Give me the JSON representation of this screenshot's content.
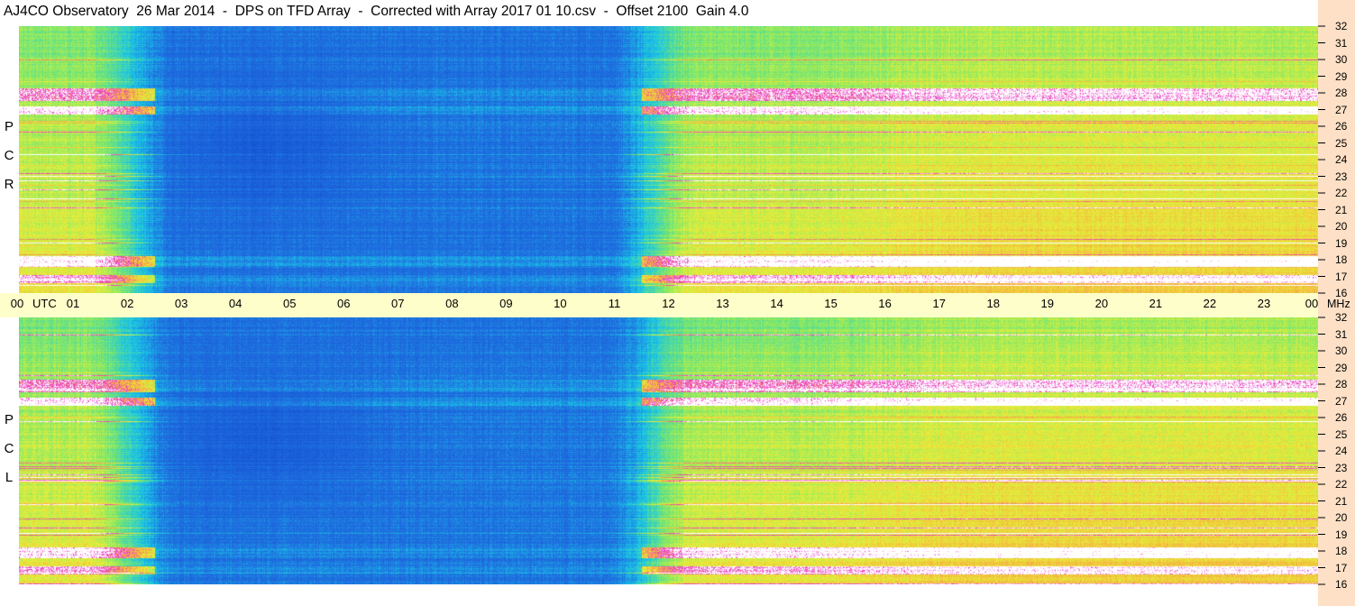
{
  "title": "AJ4CO Observatory  26 Mar 2014  -  DPS on TFD Array  -  Corrected with Array 2017 01 10.csv  -  Offset 2100  Gain 4.0",
  "panels": [
    {
      "label": [
        "P",
        "C",
        "R"
      ],
      "name": "rcp"
    },
    {
      "label": [
        "P",
        "C",
        "L"
      ],
      "name": "lcp"
    }
  ],
  "time_axis": {
    "unit_label": "UTC",
    "ticks": [
      "00",
      "01",
      "02",
      "03",
      "04",
      "05",
      "06",
      "07",
      "08",
      "09",
      "10",
      "11",
      "12",
      "13",
      "14",
      "15",
      "16",
      "17",
      "18",
      "19",
      "20",
      "21",
      "22",
      "23",
      "00"
    ]
  },
  "freq_axis": {
    "unit_label": "MHz",
    "ticks": [
      "32",
      "31",
      "30",
      "29",
      "28",
      "27",
      "26",
      "25",
      "24",
      "23",
      "22",
      "21",
      "20",
      "19",
      "18",
      "17",
      "16"
    ]
  },
  "colors": {
    "blue": "#1f6fe0",
    "cyan": "#19c6e6",
    "green": "#7de86a",
    "yellow": "#e7ef3a",
    "orange": "#f5b040",
    "magenta": "#e935c8",
    "white": "#ffffff",
    "timebar": "#fefeca",
    "scalecol": "#fde0c6"
  },
  "chart_data": {
    "type": "heatmap",
    "title": "AJ4CO Observatory  26 Mar 2014  -  DPS on TFD Array  -  Corrected with Array 2017 01 10.csv  -  Offset 2100  Gain 4.0",
    "xlabel": "UTC",
    "ylabel": "MHz",
    "x_range": [
      0,
      24
    ],
    "y_range": [
      16,
      32
    ],
    "series": [
      {
        "name": "RCP",
        "values": []
      },
      {
        "name": "LCP",
        "values": []
      }
    ]
  }
}
